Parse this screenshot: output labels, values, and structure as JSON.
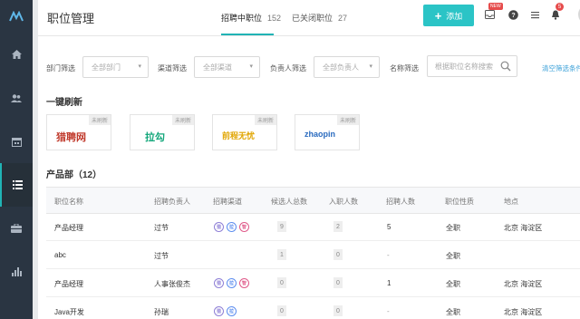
{
  "header": {
    "title": "职位管理",
    "tabs": [
      {
        "label": "招聘中职位",
        "count": "152"
      },
      {
        "label": "已关闭职位",
        "count": "27"
      }
    ],
    "add_label": "添加",
    "new_badge": "NEW",
    "notif_count": "5"
  },
  "filters": {
    "dept_label": "部门筛选",
    "dept_value": "全部部门",
    "channel_label": "渠道筛选",
    "channel_value": "全部渠道",
    "owner_label": "负责人筛选",
    "owner_value": "全部负责人",
    "name_label": "名称筛选",
    "name_placeholder": "根据职位名称搜索",
    "clear_label": "清空筛选条件"
  },
  "quick_refresh": {
    "title": "一键刷新",
    "channels": [
      {
        "name": "猎聘网",
        "tag": "未刷新",
        "color": "#c0392b"
      },
      {
        "name": "拉勾",
        "tag": "未刷新",
        "color": "#13a77b"
      },
      {
        "name": "前程无忧",
        "tag": "未刷新",
        "color": "#e1a500"
      },
      {
        "name": "zhaopin",
        "tag": "未刷新",
        "color": "#2a6bbf"
      }
    ]
  },
  "department": {
    "title": "产品部（12）"
  },
  "table": {
    "columns": [
      "职位名称",
      "招聘负责人",
      "招聘渠道",
      "候选人总数",
      "入职人数",
      "招聘人数",
      "职位性质",
      "地点"
    ],
    "rows": [
      {
        "name": "产品经理",
        "owner": "过节",
        "channels": [
          "猎",
          "拉",
          "智"
        ],
        "candidates": "9",
        "hired": "2",
        "quota": "5",
        "type": "全职",
        "location": "北京 海淀区"
      },
      {
        "name": "abc",
        "owner": "过节",
        "channels": [],
        "candidates": "1",
        "hired": "0",
        "quota": "-",
        "type": "全职",
        "location": ""
      },
      {
        "name": "产品经理",
        "owner": "人事张俊杰",
        "channels": [
          "猎",
          "拉",
          "智"
        ],
        "candidates": "0",
        "hired": "0",
        "quota": "1",
        "type": "全职",
        "location": "北京 海淀区"
      },
      {
        "name": "Java开发",
        "owner": "孙瑞",
        "channels": [
          "猎",
          "拉"
        ],
        "candidates": "0",
        "hired": "0",
        "quota": "-",
        "type": "全职",
        "location": "北京 海淀区"
      }
    ]
  }
}
